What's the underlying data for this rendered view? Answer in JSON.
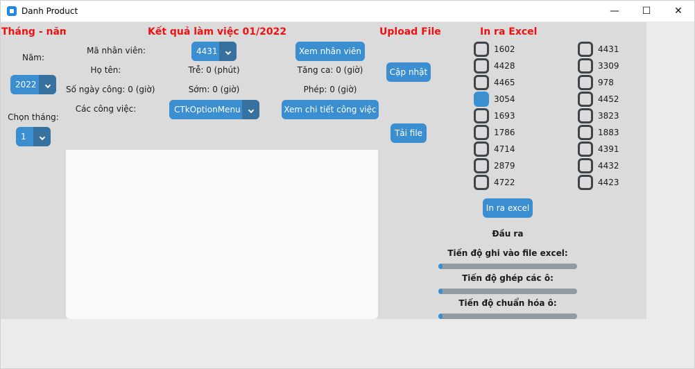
{
  "window": {
    "title": "Danh Product",
    "minimize": "—",
    "maximize": "☐",
    "close": "✕"
  },
  "left_panel": {
    "heading": "Tháng - năm",
    "year_label": "Năm:",
    "year_value": "2022",
    "month_label": "Chọn tháng:",
    "month_value": "1"
  },
  "result_panel": {
    "heading": "Kết quả làm việc 01/2022",
    "employee_id_label": "Mã nhân viên:",
    "employee_id_value": "4431",
    "view_employee_button": "Xem nhân viên",
    "name_label": "Họ tên:",
    "late_label": "Trễ: 0 (phút)",
    "overtime_label": "Tăng ca: 0 (giờ)",
    "workdays_label": "Số ngày công: 0 (giờ)",
    "early_label": "Sớm: 0 (giờ)",
    "leave_label": "Phép: 0 (giờ)",
    "tasks_label": "Các công việc:",
    "tasks_menu_value": "CTkOptionMenu",
    "view_task_details_button": "Xem chi tiết công việc"
  },
  "upload_panel": {
    "heading": "Upload File",
    "update_button": "Cập nhật",
    "load_file_button": "Tải file"
  },
  "excel_panel": {
    "heading": "In ra Excel",
    "employees": [
      {
        "id": "1602",
        "checked": false
      },
      {
        "id": "4428",
        "checked": false
      },
      {
        "id": "4465",
        "checked": false
      },
      {
        "id": "3054",
        "checked": true
      },
      {
        "id": "1693",
        "checked": false
      },
      {
        "id": "1786",
        "checked": false
      },
      {
        "id": "4714",
        "checked": false
      },
      {
        "id": "2879",
        "checked": false
      },
      {
        "id": "4722",
        "checked": false
      },
      {
        "id": "4431",
        "checked": false
      },
      {
        "id": "3309",
        "checked": false
      },
      {
        "id": "978",
        "checked": false
      },
      {
        "id": "4452",
        "checked": false
      },
      {
        "id": "3823",
        "checked": false
      },
      {
        "id": "1883",
        "checked": false
      },
      {
        "id": "4391",
        "checked": false
      },
      {
        "id": "4432",
        "checked": false
      },
      {
        "id": "4423",
        "checked": false
      }
    ],
    "export_button": "In ra excel",
    "output_heading": "Đầu ra",
    "progress": [
      {
        "label": "Tiến độ ghi vào file excel:",
        "value": 0.03
      },
      {
        "label": "Tiến độ ghép các ô:",
        "value": 0.03
      },
      {
        "label": "Tiến độ chuẩn hóa ô:",
        "value": 0.03
      }
    ]
  },
  "colors": {
    "accent": "#3b8ed0",
    "accent_dark": "#36719f",
    "heading_red": "#ee1111"
  }
}
